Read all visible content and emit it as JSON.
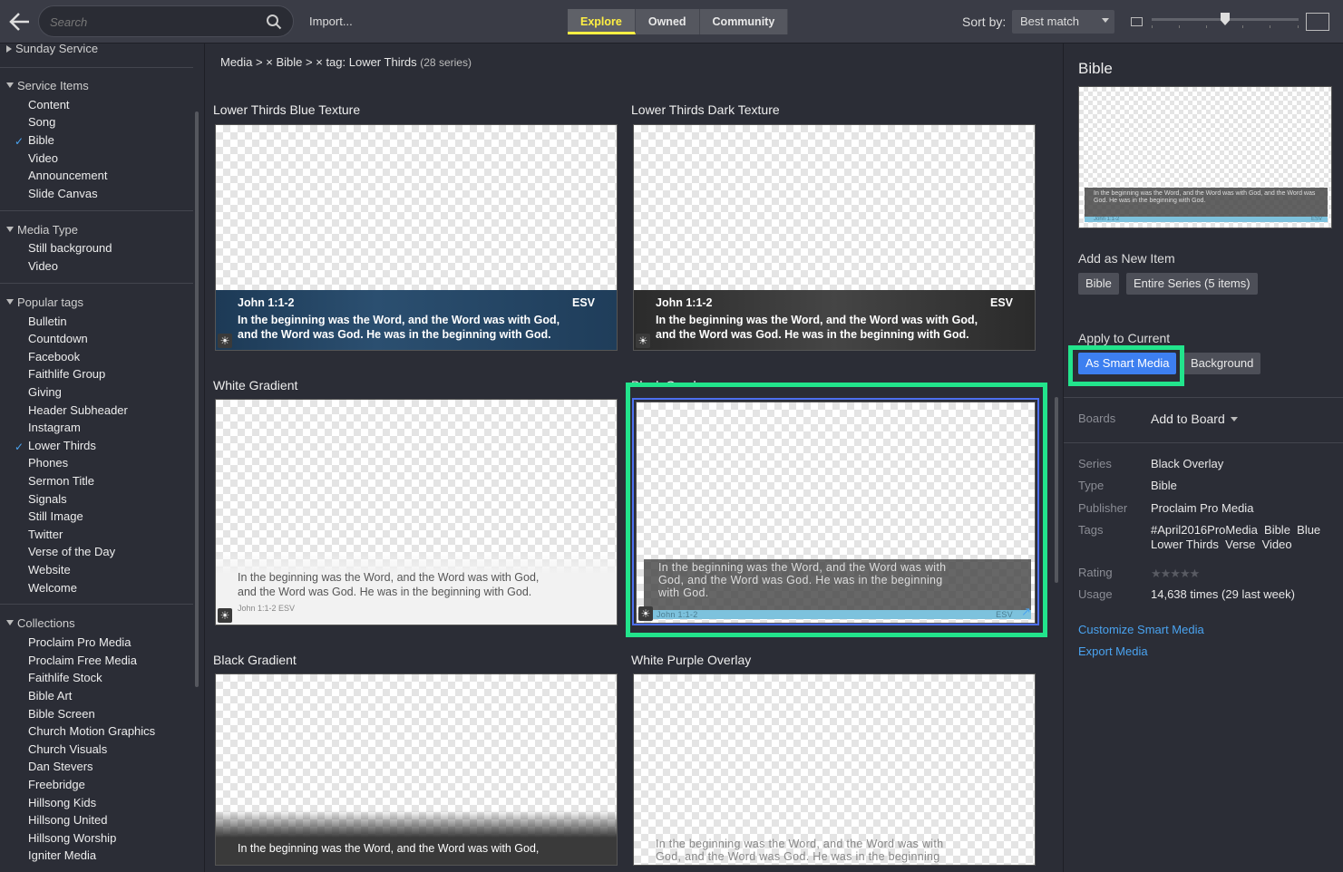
{
  "toolbar": {
    "search_placeholder": "Search",
    "import_label": "Import...",
    "tabs": [
      "Explore",
      "Owned",
      "Community"
    ],
    "sort_label": "Sort by:",
    "sort_value": "Best match"
  },
  "sidebar": {
    "top_section": "Sunday Service",
    "service_items": {
      "title": "Service Items",
      "items": [
        "Content",
        "Song",
        "Bible",
        "Video",
        "Announcement",
        "Slide Canvas"
      ]
    },
    "media_type": {
      "title": "Media Type",
      "items": [
        "Still background",
        "Video"
      ]
    },
    "popular_tags": {
      "title": "Popular tags",
      "items": [
        "Bulletin",
        "Countdown",
        "Facebook",
        "Faithlife Group",
        "Giving",
        "Header Subheader",
        "Instagram",
        "Lower Thirds",
        "Phones",
        "Sermon Title",
        "Signals",
        "Still Image",
        "Twitter",
        "Verse of the Day",
        "Website",
        "Welcome"
      ]
    },
    "collections": {
      "title": "Collections",
      "items": [
        "Proclaim Pro Media",
        "Proclaim Free Media",
        "Faithlife Stock",
        "Bible Art",
        "Bible Screen",
        "Church Motion Graphics",
        "Church Visuals",
        "Dan Stevers",
        "Freebridge",
        "Hillsong Kids",
        "Hillsong United",
        "Hillsong Worship",
        "Igniter Media"
      ]
    }
  },
  "breadcrumb": {
    "root": "Media",
    "filter1": "Bible",
    "filter2": "tag: Lower Thirds",
    "count": "(28 series)"
  },
  "cards": [
    {
      "title": "Lower Thirds Blue Texture",
      "ref": "John 1:1-2",
      "version": "ESV",
      "line1": "In the beginning was the Word, and the Word was with God,",
      "line2": "and the Word was God.  He was in the beginning with God."
    },
    {
      "title": "Lower Thirds Dark Texture",
      "ref": "John 1:1-2",
      "version": "ESV",
      "line1": "In the beginning was the Word, and the Word was with God,",
      "line2": "and the Word was God.  He was in the beginning with God."
    },
    {
      "title": "White Gradient",
      "ref": "John 1:1-2",
      "version": "ESV",
      "line1": "In the beginning was the Word, and the Word was with God,",
      "line2": "and the Word was God.   He was in the beginning with God."
    },
    {
      "title": "Black Overlay",
      "ref": "John 1:1-2",
      "version": "ESV",
      "line1": "In the beginning was the Word, and the Word was with",
      "line2": "God, and the Word was God.  He was in the beginning",
      "line3": "with God."
    },
    {
      "title": "Black Gradient",
      "line1": "In the beginning was the Word, and the Word was with God,"
    },
    {
      "title": "White Purple Overlay",
      "line1": "In the beginning was the Word, and the Word was with",
      "line2": "God, and the Word was God.  He was in the beginning"
    }
  ],
  "details": {
    "title": "Bible",
    "preview_text": "In the beginning was the Word, and the Word was with God, and the Word was God.  He was in the beginning with God.",
    "preview_ref": "John 1:1-2",
    "preview_version": "ESV",
    "add_new_label": "Add as New Item",
    "add_btn1": "Bible",
    "add_btn2": "Entire Series (5 items)",
    "apply_label": "Apply to Current",
    "apply_btn1": "As Smart Media",
    "apply_btn2": "Background",
    "boards_key": "Boards",
    "boards_value": "Add to Board",
    "meta": [
      {
        "k": "Series",
        "v": "Black Overlay"
      },
      {
        "k": "Type",
        "v": "Bible"
      },
      {
        "k": "Publisher",
        "v": "Proclaim Pro Media"
      },
      {
        "k": "Tags",
        "v": "#April2016ProMedia  Bible  Blue  Lower Thirds  Verse  Video"
      },
      {
        "k": "Rating",
        "v": ""
      },
      {
        "k": "Usage",
        "v": "14,638 times (29 last week)"
      }
    ],
    "rating": 0,
    "link1": "Customize Smart Media",
    "link2": "Export Media"
  },
  "colors": {
    "accent_yellow": "#ffef43",
    "primary_blue": "#3d7ff0",
    "highlight_green": "#22e48c",
    "link": "#4aa3f0"
  }
}
